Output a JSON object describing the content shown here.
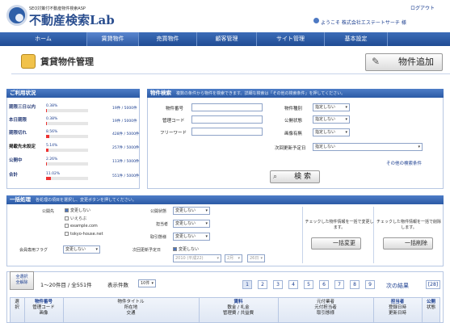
{
  "header": {
    "logo_subtitle": "SEO対策付不動産物件検索ASP",
    "logo_text": "不動産検索Lab",
    "logout_label": "ログアウト",
    "welcome_text": "ようこそ 株式会社エステートサーチ 様"
  },
  "nav": {
    "items": [
      {
        "label": "ホーム"
      },
      {
        "label": "賃貸物件"
      },
      {
        "label": "売買物件"
      },
      {
        "label": "顧客管理"
      },
      {
        "label": "サイト管理"
      },
      {
        "label": "基本設定"
      }
    ]
  },
  "page": {
    "title": "賃貸物件管理",
    "add_button_label": "物件追加"
  },
  "status": {
    "heading": "ご利用状況",
    "rows": [
      {
        "label": "期限三日以内",
        "pct": "0.38%",
        "count": "19件",
        "total": "/ 5000件",
        "fill": 0.0038
      },
      {
        "label": "本日期限",
        "pct": "0.38%",
        "count": "19件",
        "total": "/ 5000件",
        "fill": 0.0038
      },
      {
        "label": "期限切れ",
        "pct": "8.56%",
        "count": "428件",
        "total": "/ 5000件",
        "fill": 0.0856
      },
      {
        "label": "掲載先未設定",
        "pct": "5.14%",
        "count": "257件",
        "total": "/ 5000件",
        "fill": 0.0514
      },
      {
        "label": "公開中",
        "pct": "2.26%",
        "count": "113件",
        "total": "/ 5000件",
        "fill": 0.0226
      },
      {
        "label": "合計",
        "pct": "11.02%",
        "count": "551件",
        "total": "/ 5000件",
        "fill": 0.1102
      }
    ]
  },
  "search": {
    "heading": "物件検索",
    "note": "複数の条件から物件を検索できます。詳細な検索は「その他の検索条件」を押してください。",
    "fields": {
      "property_no": "物件番号",
      "manage_code": "管理コード",
      "free_word": "フリーワード",
      "type_label": "物件種別",
      "public_label": "公開状態",
      "image_label": "画像有無",
      "update_label": "次回更新予定日"
    },
    "select_default": "指定しない",
    "button_label": "検 索",
    "other_link": "その他の検索条件"
  },
  "bulk": {
    "heading": "一括処理",
    "note": "各処理の項目を選択し、変更ボタンを押してください。",
    "public_target_label": "公開先",
    "public_targets": [
      "変更しない",
      "いえらぶ",
      "example.com",
      "tokyo-house.net"
    ],
    "member_flag_label": "会員専用フラグ",
    "member_flag_value": "変更しない",
    "public_state_label": "公開状態",
    "public_state_value": "変更しない",
    "person_label": "担当者",
    "person_value": "変更しない",
    "trade_label": "取引態様",
    "trade_value": "変更しない",
    "next_update_label": "次回更新予定日",
    "next_update_check": "変更しない",
    "date_year": "2010 (平成22)",
    "date_month": "2月",
    "date_day": "26日",
    "change_note": "チェックした物件情報を一括で変更します。",
    "change_button": "一括変更",
    "delete_note": "チェックした物件情報を一括で削除します。",
    "delete_button": "一括削除"
  },
  "results": {
    "select_all_line1": "全選択",
    "select_all_line2": "全解除",
    "range_text": "1〜20件目 / 全551件",
    "perpage_label": "表示件数",
    "perpage_value": "10件",
    "pages": [
      "1",
      "2",
      "3",
      "4",
      "5",
      "6",
      "7",
      "8",
      "9"
    ],
    "next_label": "次の結果",
    "last_label": "[28]",
    "columns": [
      {
        "line1": "選",
        "line2": "択"
      },
      {
        "line1": "物件番号",
        "line2": "管理コード",
        "line3": "画像"
      },
      {
        "line1": "物件タイトル",
        "line2": "所在地",
        "line3": "交通"
      },
      {
        "line1": "賃料",
        "line2": "敷金 / 礼金",
        "line3": "管理費 / 共益費"
      },
      {
        "line1": "元付業者",
        "line2": "元付担当者",
        "line3": "取引態様"
      },
      {
        "line1": "担当者",
        "line2": "登録日時",
        "line3": "更新日時"
      },
      {
        "line1": "公開",
        "line2": "状態"
      }
    ]
  }
}
